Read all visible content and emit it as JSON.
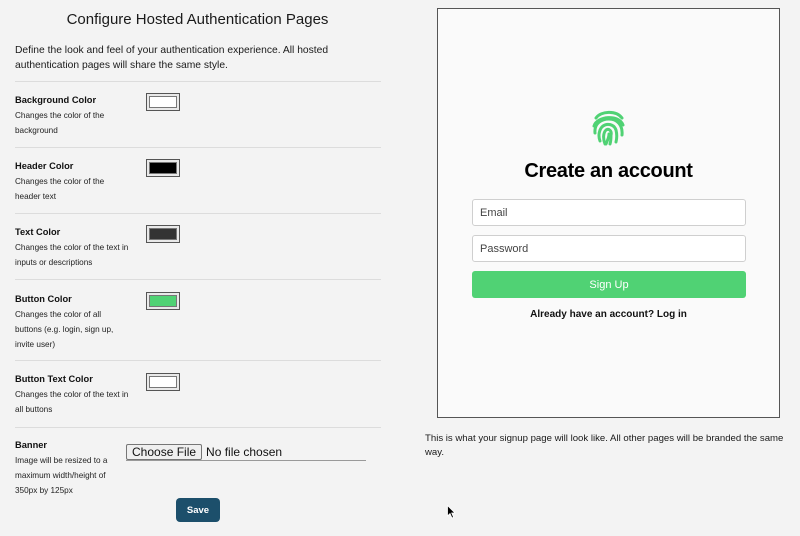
{
  "config": {
    "title": "Configure Hosted Authentication Pages",
    "intro": "Define the look and feel of your authentication experience. All hosted authentication pages will share the same style.",
    "settings": [
      {
        "label": "Background Color",
        "description": "Changes the color of the background",
        "color": "#ffffff"
      },
      {
        "label": "Header Color",
        "description": "Changes the color of the header text",
        "color": "#000000"
      },
      {
        "label": "Text Color",
        "description": "Changes the color of the text in inputs or descriptions",
        "color": "#333333"
      },
      {
        "label": "Button Color",
        "description": "Changes the color of all buttons (e.g. login, sign up, invite user)",
        "color": "#50d274"
      },
      {
        "label": "Button Text Color",
        "description": "Changes the color of the text in all buttons",
        "color": "#ffffff"
      }
    ],
    "banner": {
      "label": "Banner",
      "description": "Image will be resized to a maximum width/height of 350px by 125px",
      "file_button": "Choose File",
      "file_status": "No file chosen"
    },
    "save_label": "Save"
  },
  "preview": {
    "icon": "fingerprint-icon",
    "heading": "Create an account",
    "email_placeholder": "Email",
    "password_placeholder": "Password",
    "signup_label": "Sign Up",
    "login_text": "Already have an account? Log in",
    "caption": "This is what your signup page will look like. All other pages will be branded the same way."
  },
  "colors": {
    "accent": "#50d274",
    "save_button": "#1c4f6b"
  }
}
